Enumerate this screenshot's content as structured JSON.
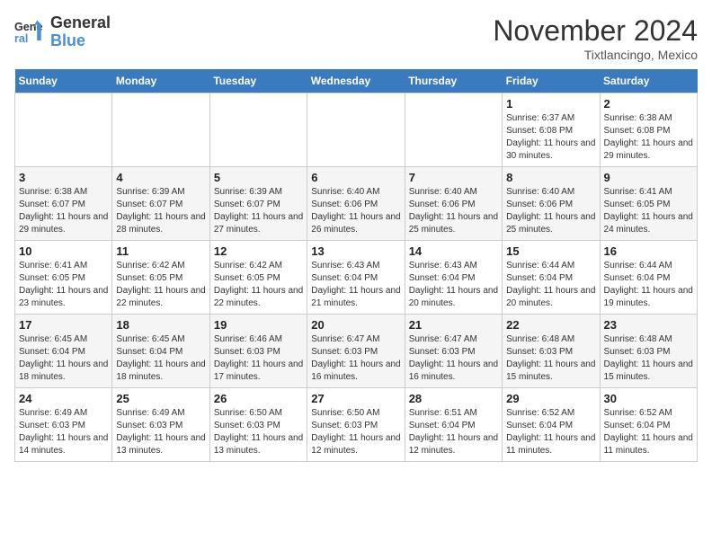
{
  "header": {
    "logo_line1": "General",
    "logo_line2": "Blue",
    "month_title": "November 2024",
    "subtitle": "Tixtlancingo, Mexico"
  },
  "weekdays": [
    "Sunday",
    "Monday",
    "Tuesday",
    "Wednesday",
    "Thursday",
    "Friday",
    "Saturday"
  ],
  "weeks": [
    [
      {
        "day": "",
        "info": ""
      },
      {
        "day": "",
        "info": ""
      },
      {
        "day": "",
        "info": ""
      },
      {
        "day": "",
        "info": ""
      },
      {
        "day": "",
        "info": ""
      },
      {
        "day": "1",
        "info": "Sunrise: 6:37 AM\nSunset: 6:08 PM\nDaylight: 11 hours and 30 minutes."
      },
      {
        "day": "2",
        "info": "Sunrise: 6:38 AM\nSunset: 6:08 PM\nDaylight: 11 hours and 29 minutes."
      }
    ],
    [
      {
        "day": "3",
        "info": "Sunrise: 6:38 AM\nSunset: 6:07 PM\nDaylight: 11 hours and 29 minutes."
      },
      {
        "day": "4",
        "info": "Sunrise: 6:39 AM\nSunset: 6:07 PM\nDaylight: 11 hours and 28 minutes."
      },
      {
        "day": "5",
        "info": "Sunrise: 6:39 AM\nSunset: 6:07 PM\nDaylight: 11 hours and 27 minutes."
      },
      {
        "day": "6",
        "info": "Sunrise: 6:40 AM\nSunset: 6:06 PM\nDaylight: 11 hours and 26 minutes."
      },
      {
        "day": "7",
        "info": "Sunrise: 6:40 AM\nSunset: 6:06 PM\nDaylight: 11 hours and 25 minutes."
      },
      {
        "day": "8",
        "info": "Sunrise: 6:40 AM\nSunset: 6:06 PM\nDaylight: 11 hours and 25 minutes."
      },
      {
        "day": "9",
        "info": "Sunrise: 6:41 AM\nSunset: 6:05 PM\nDaylight: 11 hours and 24 minutes."
      }
    ],
    [
      {
        "day": "10",
        "info": "Sunrise: 6:41 AM\nSunset: 6:05 PM\nDaylight: 11 hours and 23 minutes."
      },
      {
        "day": "11",
        "info": "Sunrise: 6:42 AM\nSunset: 6:05 PM\nDaylight: 11 hours and 22 minutes."
      },
      {
        "day": "12",
        "info": "Sunrise: 6:42 AM\nSunset: 6:05 PM\nDaylight: 11 hours and 22 minutes."
      },
      {
        "day": "13",
        "info": "Sunrise: 6:43 AM\nSunset: 6:04 PM\nDaylight: 11 hours and 21 minutes."
      },
      {
        "day": "14",
        "info": "Sunrise: 6:43 AM\nSunset: 6:04 PM\nDaylight: 11 hours and 20 minutes."
      },
      {
        "day": "15",
        "info": "Sunrise: 6:44 AM\nSunset: 6:04 PM\nDaylight: 11 hours and 20 minutes."
      },
      {
        "day": "16",
        "info": "Sunrise: 6:44 AM\nSunset: 6:04 PM\nDaylight: 11 hours and 19 minutes."
      }
    ],
    [
      {
        "day": "17",
        "info": "Sunrise: 6:45 AM\nSunset: 6:04 PM\nDaylight: 11 hours and 18 minutes."
      },
      {
        "day": "18",
        "info": "Sunrise: 6:45 AM\nSunset: 6:04 PM\nDaylight: 11 hours and 18 minutes."
      },
      {
        "day": "19",
        "info": "Sunrise: 6:46 AM\nSunset: 6:03 PM\nDaylight: 11 hours and 17 minutes."
      },
      {
        "day": "20",
        "info": "Sunrise: 6:47 AM\nSunset: 6:03 PM\nDaylight: 11 hours and 16 minutes."
      },
      {
        "day": "21",
        "info": "Sunrise: 6:47 AM\nSunset: 6:03 PM\nDaylight: 11 hours and 16 minutes."
      },
      {
        "day": "22",
        "info": "Sunrise: 6:48 AM\nSunset: 6:03 PM\nDaylight: 11 hours and 15 minutes."
      },
      {
        "day": "23",
        "info": "Sunrise: 6:48 AM\nSunset: 6:03 PM\nDaylight: 11 hours and 15 minutes."
      }
    ],
    [
      {
        "day": "24",
        "info": "Sunrise: 6:49 AM\nSunset: 6:03 PM\nDaylight: 11 hours and 14 minutes."
      },
      {
        "day": "25",
        "info": "Sunrise: 6:49 AM\nSunset: 6:03 PM\nDaylight: 11 hours and 13 minutes."
      },
      {
        "day": "26",
        "info": "Sunrise: 6:50 AM\nSunset: 6:03 PM\nDaylight: 11 hours and 13 minutes."
      },
      {
        "day": "27",
        "info": "Sunrise: 6:50 AM\nSunset: 6:03 PM\nDaylight: 11 hours and 12 minutes."
      },
      {
        "day": "28",
        "info": "Sunrise: 6:51 AM\nSunset: 6:04 PM\nDaylight: 11 hours and 12 minutes."
      },
      {
        "day": "29",
        "info": "Sunrise: 6:52 AM\nSunset: 6:04 PM\nDaylight: 11 hours and 11 minutes."
      },
      {
        "day": "30",
        "info": "Sunrise: 6:52 AM\nSunset: 6:04 PM\nDaylight: 11 hours and 11 minutes."
      }
    ]
  ]
}
